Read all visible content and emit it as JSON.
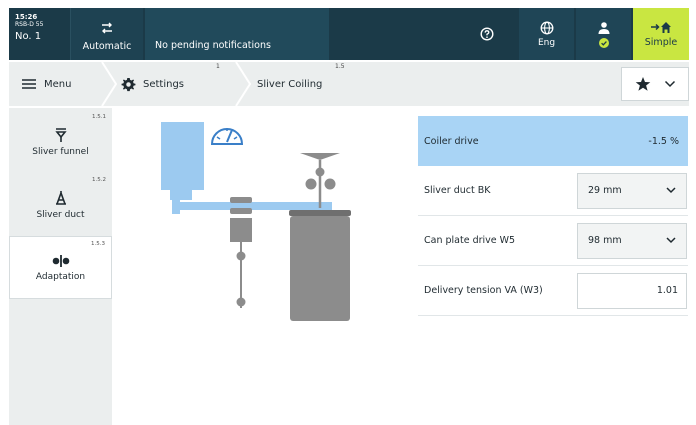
{
  "topbar": {
    "time": "15:26",
    "machine_code": "RSB-D 55",
    "machine_no": "No. 1",
    "mode_label": "Automatic",
    "notifications": "No pending notifications",
    "language_label": "Eng",
    "simple_label": "Simple"
  },
  "breadcrumb": {
    "menu_label": "Menu",
    "settings_label": "Settings",
    "settings_num": "1",
    "coiling_label": "Sliver Coiling",
    "coiling_num": "1.5"
  },
  "sidebar": {
    "items": [
      {
        "label": "Sliver funnel",
        "num": "1.5.1",
        "icon": "funnel-icon"
      },
      {
        "label": "Sliver duct",
        "num": "1.5.2",
        "icon": "duct-icon"
      },
      {
        "label": "Adaptation",
        "num": "1.5.3",
        "icon": "adaptation-icon"
      }
    ]
  },
  "params": {
    "coiler_drive": {
      "label": "Coiler drive",
      "value": "-1.5 %"
    },
    "sliver_duct": {
      "label": "Sliver duct BK",
      "value": "29 mm"
    },
    "can_plate": {
      "label": "Can plate drive W5",
      "value": "98 mm"
    },
    "delivery_tension": {
      "label": "Delivery tension VA (W3)",
      "value": "1.01"
    }
  },
  "colors": {
    "topbar": "#1b3a48",
    "accent_green": "#c9e641",
    "highlight_blue": "#a9d4f5",
    "machine_blue": "#9ccaf0",
    "machine_grey": "#8c8c8c"
  }
}
